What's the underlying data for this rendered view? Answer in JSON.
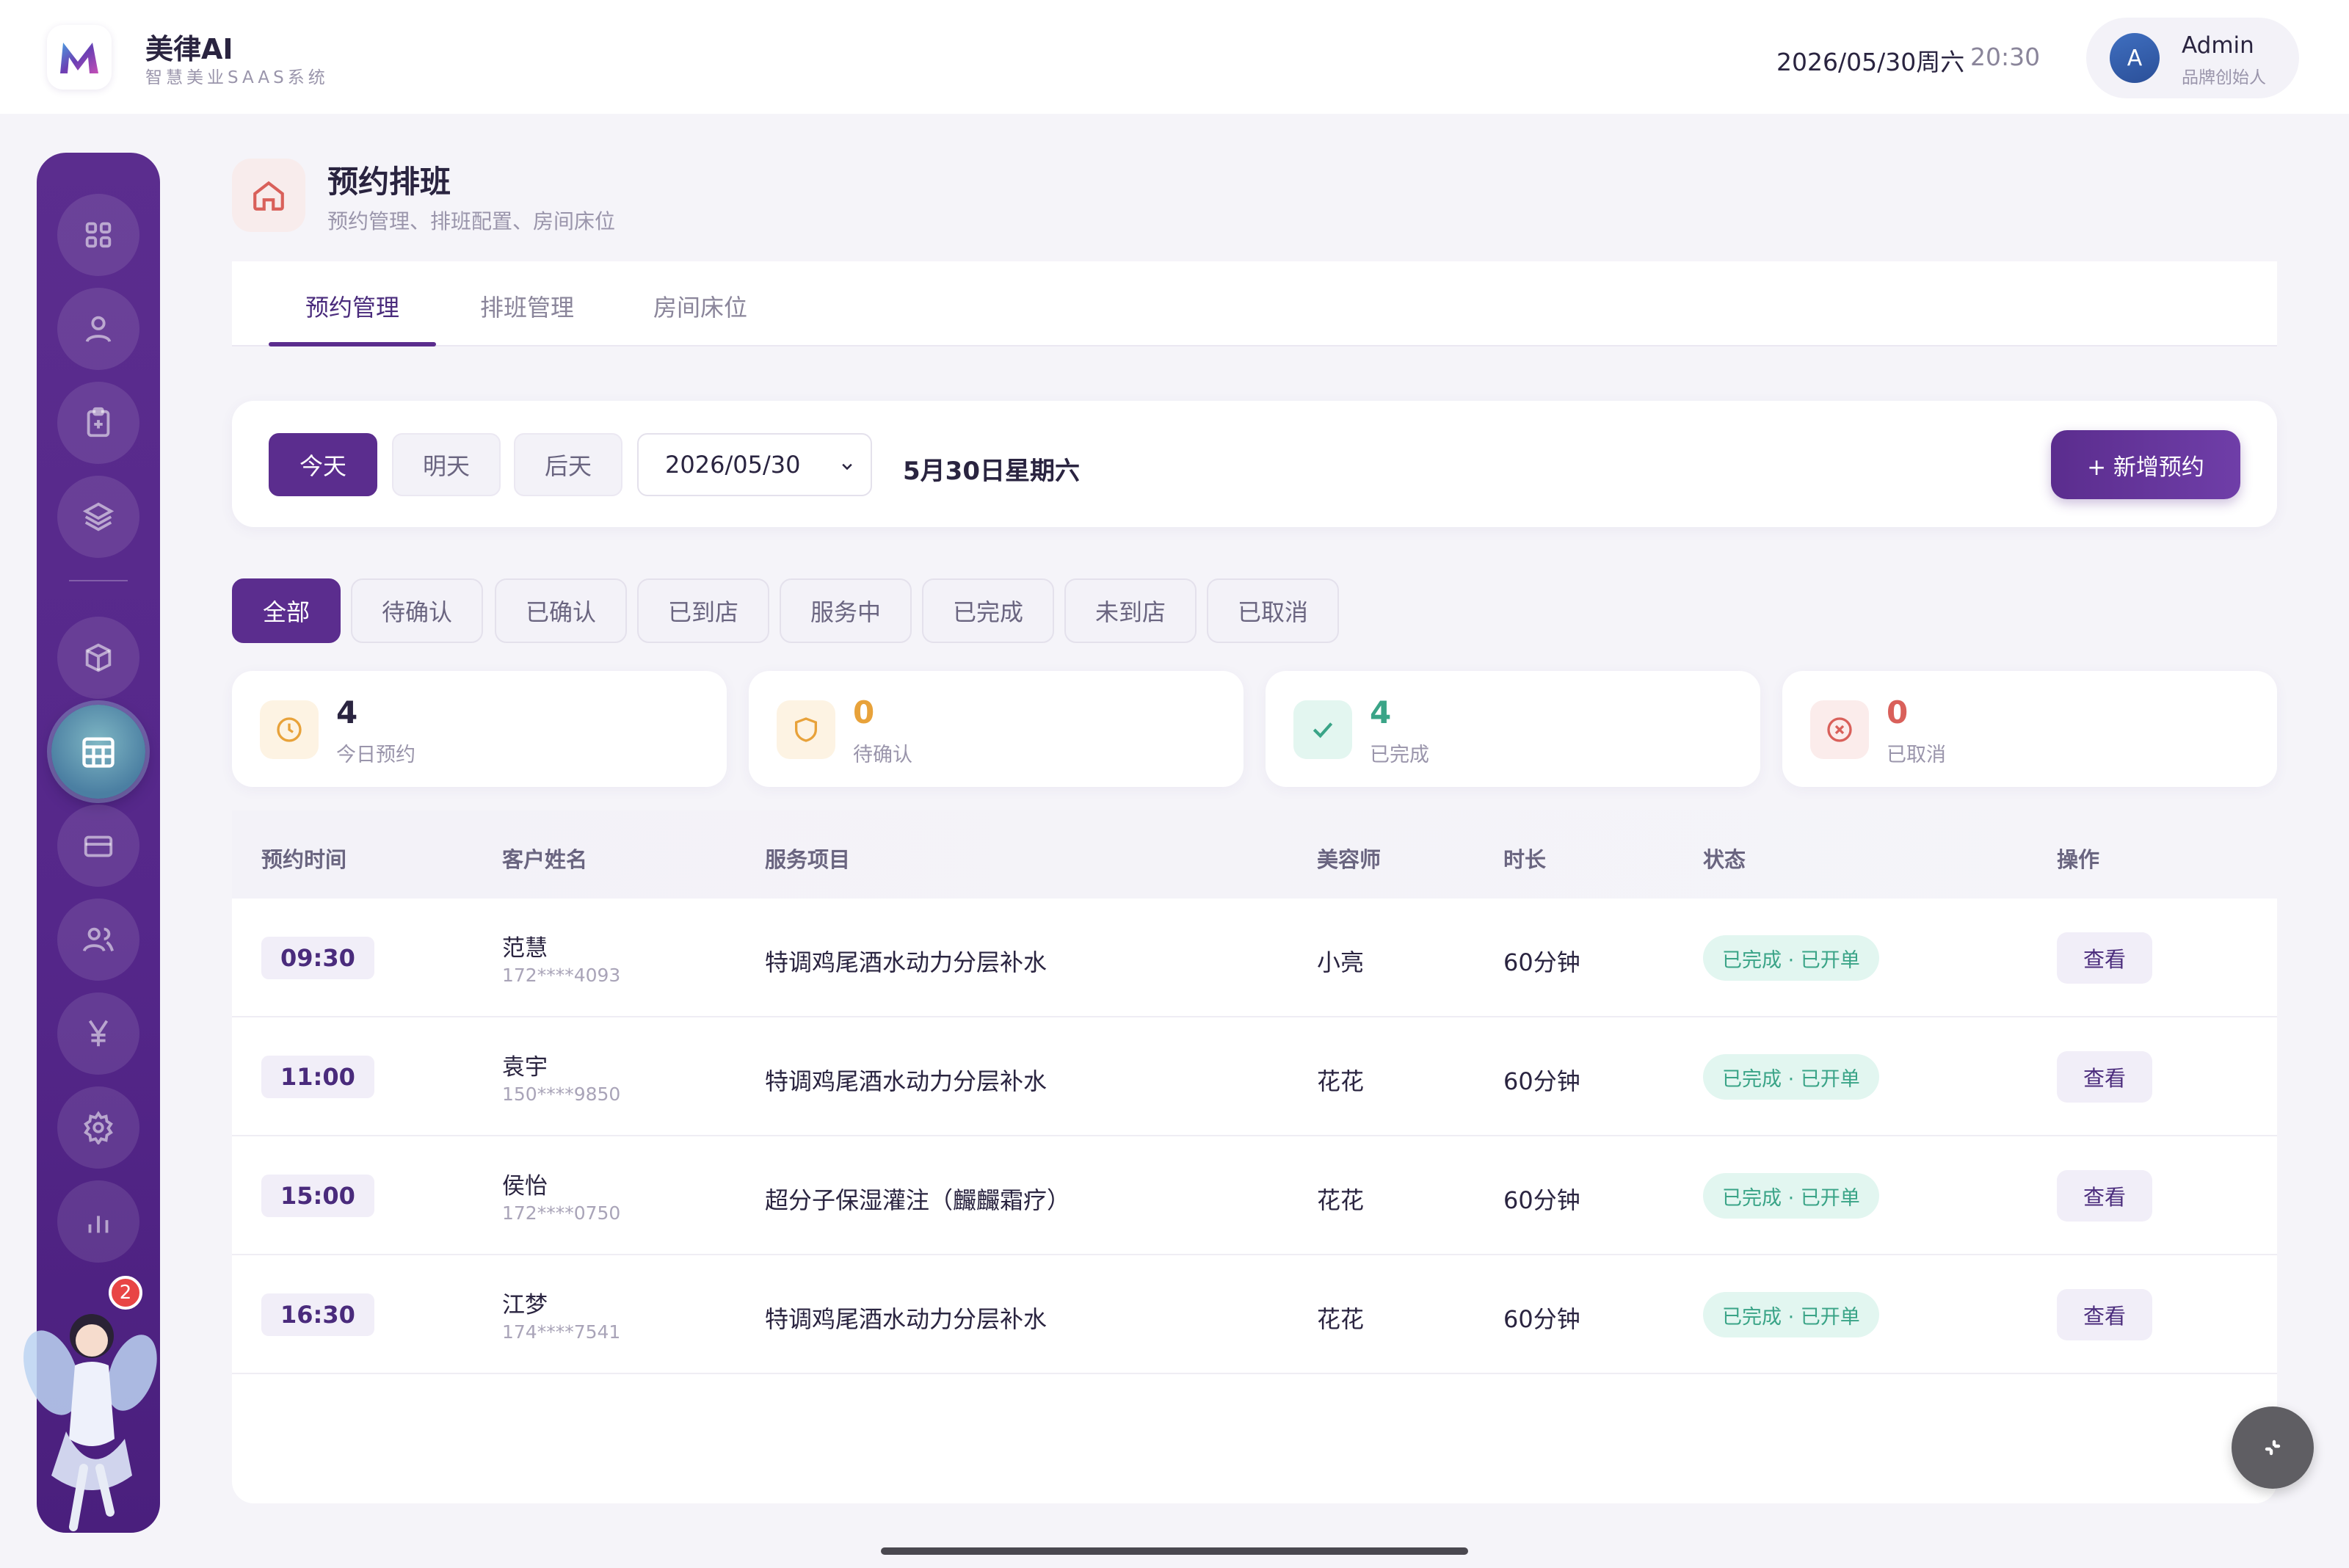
{
  "header": {
    "brand_name": "美律AI",
    "brand_sub": "智慧美业SAAS系统",
    "date": "2026/05/30周六",
    "time": "20:30",
    "user": {
      "avatar_letter": "A",
      "name": "Admin",
      "role": "品牌创始人"
    }
  },
  "sidebar": {
    "items": [
      {
        "icon": "grid-icon"
      },
      {
        "icon": "user-icon"
      },
      {
        "icon": "clipboard-icon"
      },
      {
        "icon": "layers-icon"
      },
      {
        "icon": "box-icon"
      },
      {
        "icon": "calendar-icon",
        "active": true
      },
      {
        "icon": "card-icon"
      },
      {
        "icon": "users-icon"
      },
      {
        "icon": "yen-icon"
      },
      {
        "icon": "gear-icon"
      },
      {
        "icon": "bar-chart-icon"
      }
    ],
    "notification_count": "2"
  },
  "page": {
    "title": "预约排班",
    "subtitle": "预约管理、排班配置、房间床位"
  },
  "tabs": [
    {
      "label": "预约管理",
      "active": true
    },
    {
      "label": "排班管理"
    },
    {
      "label": "房间床位"
    }
  ],
  "date_panel": {
    "days": [
      {
        "label": "今天",
        "active": true
      },
      {
        "label": "明天"
      },
      {
        "label": "后天"
      }
    ],
    "selected_date": "2026/05/30",
    "date_label": "5月30日星期六",
    "new_button": "+ 新增预约"
  },
  "filters": [
    {
      "label": "全部",
      "active": true
    },
    {
      "label": "待确认"
    },
    {
      "label": "已确认"
    },
    {
      "label": "已到店"
    },
    {
      "label": "服务中"
    },
    {
      "label": "已完成"
    },
    {
      "label": "未到店"
    },
    {
      "label": "已取消"
    }
  ],
  "stats": [
    {
      "value": "4",
      "label": "今日预约",
      "color": "#2a2440",
      "icon": "clock-icon",
      "icon_bg": "#fdf3e3",
      "icon_color": "#e8a23a"
    },
    {
      "value": "0",
      "label": "待确认",
      "color": "#e8a23a",
      "icon": "shield-icon",
      "icon_bg": "#fdf3e3",
      "icon_color": "#e8a23a"
    },
    {
      "value": "4",
      "label": "已完成",
      "color": "#3aa487",
      "icon": "check-icon",
      "icon_bg": "#e3f6f0",
      "icon_color": "#3aa487"
    },
    {
      "value": "0",
      "label": "已取消",
      "color": "#d9605a",
      "icon": "x-circle-icon",
      "icon_bg": "#fbeceb",
      "icon_color": "#d9605a"
    }
  ],
  "table": {
    "headers": [
      "预约时间",
      "客户姓名",
      "服务项目",
      "美容师",
      "时长",
      "状态",
      "操作"
    ],
    "rows": [
      {
        "time": "09:30",
        "name": "范慧",
        "phone": "172****4093",
        "service": "特调鸡尾酒水动力分层补水",
        "staff": "小亮",
        "duration": "60分钟",
        "status": "已完成 · 已开单",
        "action": "查看"
      },
      {
        "time": "11:00",
        "name": "袁宇",
        "phone": "150****9850",
        "service": "特调鸡尾酒水动力分层补水",
        "staff": "花花",
        "duration": "60分钟",
        "status": "已完成 · 已开单",
        "action": "查看"
      },
      {
        "time": "15:00",
        "name": "侯怡",
        "phone": "172****0750",
        "service": "超分子保湿灌注（麣麣霜疗）",
        "staff": "花花",
        "duration": "60分钟",
        "status": "已完成 · 已开单",
        "action": "查看"
      },
      {
        "time": "16:30",
        "name": "江梦",
        "phone": "174****7541",
        "service": "特调鸡尾酒水动力分层补水",
        "staff": "花花",
        "duration": "60分钟",
        "status": "已完成 · 已开单",
        "action": "查看"
      }
    ]
  },
  "colors": {
    "primary": "#5b2d8e",
    "success": "#3aa487"
  }
}
